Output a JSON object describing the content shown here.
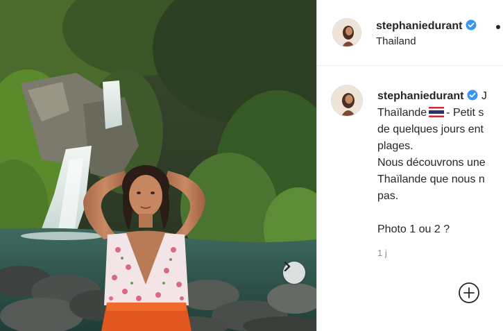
{
  "post": {
    "username": "stephaniedurant",
    "verified": true,
    "location": "Thailand",
    "more_options": "…",
    "caption_meta": "J",
    "caption_lines": [
      "Thaïlande",
      "- Petit s",
      "de quelques jours ent",
      "plages.",
      "Nous découvrons une",
      "Thaïlande que nous n",
      "pas.",
      "Photo 1 ou 2 ?"
    ],
    "timestamp": "1 j"
  },
  "icons": {
    "verified": "verified-badge-icon",
    "flag": "thailand-flag-icon",
    "next": "chevron-right-icon",
    "add": "plus-circle-icon"
  },
  "colors": {
    "verified": "#3897f0",
    "text": "#262626",
    "muted": "#8e8e8e"
  }
}
